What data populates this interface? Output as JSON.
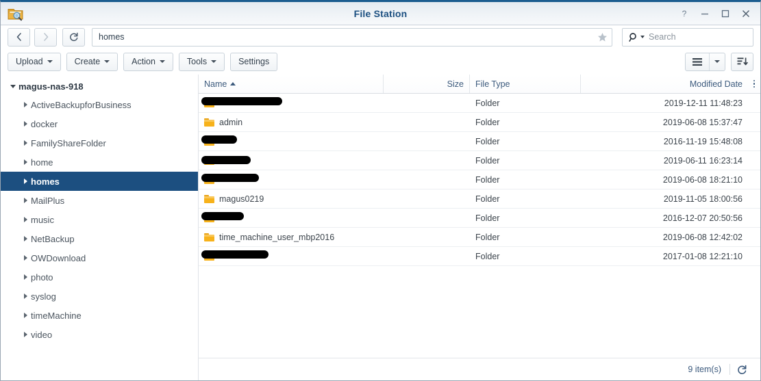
{
  "window": {
    "title": "File Station",
    "icon": "folder-search-icon",
    "controls": [
      {
        "name": "help-button",
        "glyph": "?"
      },
      {
        "name": "minimize-button",
        "glyph": "—"
      },
      {
        "name": "maximize-button",
        "glyph": "□"
      },
      {
        "name": "close-button",
        "glyph": "✕"
      }
    ]
  },
  "addressbar": {
    "back_icon": "chevron-left-icon",
    "forward_icon": "chevron-right-icon",
    "refresh_icon": "refresh-icon",
    "path_value": "homes",
    "path_placeholder": "",
    "favorite_icon": "star-icon",
    "search_placeholder": "Search",
    "search_value": "",
    "search_icon": "magnifier-icon"
  },
  "toolbar": {
    "buttons": [
      {
        "label": "Upload",
        "has_caret": true,
        "name": "upload-button"
      },
      {
        "label": "Create",
        "has_caret": true,
        "name": "create-button"
      },
      {
        "label": "Action",
        "has_caret": true,
        "name": "action-button"
      },
      {
        "label": "Tools",
        "has_caret": true,
        "name": "tools-button"
      },
      {
        "label": "Settings",
        "has_caret": false,
        "name": "settings-button"
      }
    ],
    "view_mode_icon": "list-view-icon",
    "view_mode_caret_icon": "chevron-down-icon",
    "sort_icon": "sort-descending-icon"
  },
  "sidebar": {
    "root": {
      "label": "magus-nas-918",
      "expanded": true
    },
    "items": [
      {
        "label": "ActiveBackupforBusiness",
        "selected": false
      },
      {
        "label": "docker",
        "selected": false
      },
      {
        "label": "FamilyShareFolder",
        "selected": false
      },
      {
        "label": "home",
        "selected": false
      },
      {
        "label": "homes",
        "selected": true
      },
      {
        "label": "MailPlus",
        "selected": false
      },
      {
        "label": "music",
        "selected": false
      },
      {
        "label": "NetBackup",
        "selected": false
      },
      {
        "label": "OWDownload",
        "selected": false
      },
      {
        "label": "photo",
        "selected": false
      },
      {
        "label": "syslog",
        "selected": false
      },
      {
        "label": "timeMachine",
        "selected": false
      },
      {
        "label": "video",
        "selected": false
      }
    ]
  },
  "filelist": {
    "columns": {
      "name": "Name",
      "size": "Size",
      "type": "File Type",
      "date": "Modified Date"
    },
    "sort_column": "Name",
    "sort_direction": "asc",
    "column_menu_icon": "more-vertical-icon",
    "rows": [
      {
        "name": "",
        "redacted": true,
        "redact_w": 118,
        "size": "",
        "type": "Folder",
        "date": "2019-12-11 11:48:23"
      },
      {
        "name": "admin",
        "redacted": false,
        "redact_w": 0,
        "size": "",
        "type": "Folder",
        "date": "2019-06-08 15:37:47"
      },
      {
        "name": "",
        "redacted": true,
        "redact_w": 52,
        "size": "",
        "type": "Folder",
        "date": "2016-11-19 15:48:08"
      },
      {
        "name": "",
        "redacted": true,
        "redact_w": 72,
        "size": "",
        "type": "Folder",
        "date": "2019-06-11 16:23:14"
      },
      {
        "name": "",
        "redacted": true,
        "redact_w": 84,
        "size": "",
        "type": "Folder",
        "date": "2019-06-08 18:21:10"
      },
      {
        "name": "magus0219",
        "redacted": false,
        "redact_w": 0,
        "size": "",
        "type": "Folder",
        "date": "2019-11-05 18:00:56"
      },
      {
        "name": "",
        "redacted": true,
        "redact_w": 62,
        "size": "",
        "type": "Folder",
        "date": "2016-12-07 20:50:56"
      },
      {
        "name": "time_machine_user_mbp2016",
        "redacted": false,
        "redact_w": 0,
        "size": "",
        "type": "Folder",
        "date": "2019-06-08 12:42:02"
      },
      {
        "name": "",
        "redacted": true,
        "redact_w": 98,
        "size": "",
        "type": "Folder",
        "date": "2017-01-08 12:21:10"
      }
    ]
  },
  "footer": {
    "item_count": "9 item(s)",
    "refresh_icon": "refresh-icon"
  },
  "colors": {
    "accent": "#1c4f80",
    "title_text": "#1b4f80",
    "folder": "#f7b21b",
    "header_text": "#3c5a7d"
  }
}
